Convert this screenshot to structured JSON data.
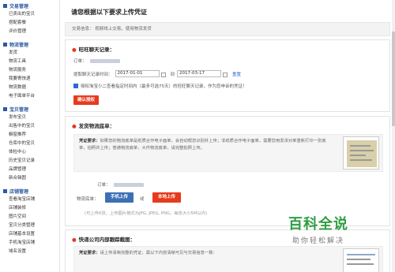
{
  "sidebar": {
    "groups": [
      {
        "title": "交易管理",
        "items": [
          "已卖出的宝贝",
          "搭配套餐",
          "评价管理"
        ]
      },
      {
        "title": "物流管理",
        "items": [
          "发货",
          "物流工具",
          "物流服务",
          "我要寄快递",
          "物流数据",
          "电子面单平台"
        ]
      },
      {
        "title": "宝贝管理",
        "items": [
          "发布宝贝",
          "出售中的宝贝",
          "橱窗推荐",
          "仓库中的宝贝",
          "体检中心",
          "历史宝贝记录",
          "品牌管理",
          "新合辑图"
        ]
      },
      {
        "title": "店铺管理",
        "items": [
          "查看淘宝店铺",
          "店铺装修",
          "图片空间",
          "宝贝分类管理",
          "店铺基本设置",
          "手机淘宝店铺",
          "域名设置"
        ]
      }
    ]
  },
  "main": {
    "title": "请您根据以下要求上传凭证",
    "notice": "交易信息：  视频线上交易，使用物流发货"
  },
  "section1": {
    "title": "旺旺聊天记录：",
    "order_label": "订单：",
    "time_label": "提取聊天记录时间：",
    "date_from": "2017-01-01",
    "to_label": "到",
    "date_to": "2017-03-17",
    "reset_link": "重置",
    "checkbox_text": "授权淘宝小二查看指定时间内（最多可选75天）的旺旺聊天记录，作为您申诉的凭证！",
    "button": "确认授权"
  },
  "section2": {
    "title": "发货物流底单：",
    "req_label": "凭证要求：",
    "req_text": "如果您的物流底单是纸质合作电子面单，会自动帮您识别并上传；非纸质合作电子面单，需要您用发货对单重新打印一张底单，拍照并上传；普通物流底单，大件物流底单，请完整拍照上传。",
    "order_label": "订单：",
    "upload_label": "物流底单：",
    "mobile_button": "手机上传",
    "or_text": "或",
    "local_button": "本地上传",
    "hint": "(可上传6张，上传图片格式为JPG, JPEG, PNG，每张大小5M以内)"
  },
  "section3": {
    "title": "快递公司内部跟踪截图：",
    "req_label": "凭证要求：",
    "req_text": "请上传清晰完整的凭证，需以下内容清晰可见与交易信息一致："
  },
  "watermark": {
    "main": "百科全说",
    "sub": "助你轻松解决"
  },
  "colors": {
    "accent_red": "#e63b1e",
    "accent_blue": "#3d6fb5",
    "sidebar_blue": "#2c5aa0",
    "watermark_green": "#2f9e43"
  }
}
